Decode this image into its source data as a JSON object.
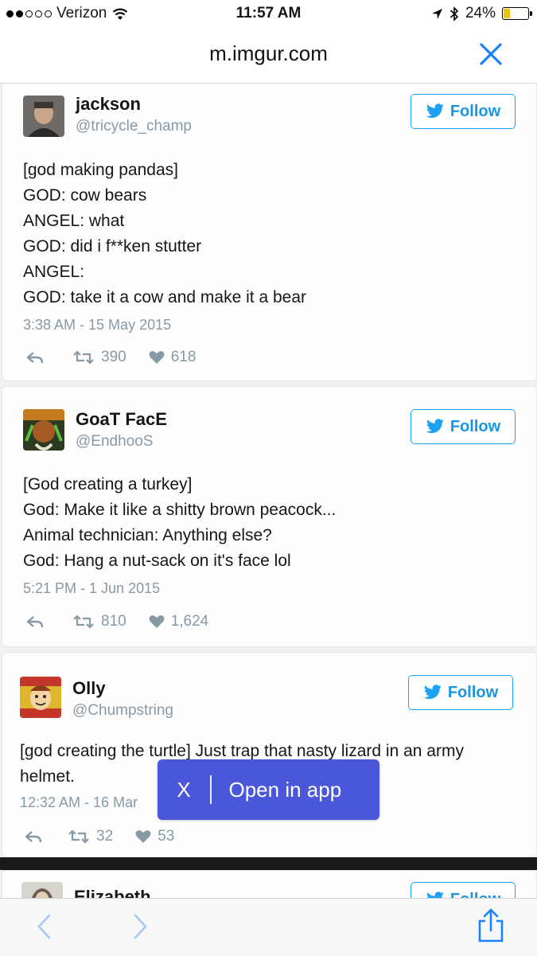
{
  "status_bar": {
    "carrier": "Verizon",
    "time": "11:57 AM",
    "battery": "24%",
    "battery_color": "#f3c00e"
  },
  "browser": {
    "url": "m.imgur.com"
  },
  "tweets": [
    {
      "name": "jackson",
      "handle": "@tricycle_champ",
      "follow_label": "Follow",
      "lines": [
        "[god making pandas]",
        "GOD: cow bears",
        "ANGEL: what",
        "GOD: did i f**ken stutter",
        "ANGEL:",
        "GOD: take it a cow and make it a bear"
      ],
      "timestamp": "3:38 AM - 15 May 2015",
      "retweets": "390",
      "likes": "618"
    },
    {
      "name": "GoaT FacE",
      "handle": "@EndhooS",
      "follow_label": "Follow",
      "lines": [
        "[God creating a turkey]",
        "God: Make it like a shitty brown peacock...",
        "Animal technician: Anything else?",
        "God: Hang a nut-sack on it's face lol"
      ],
      "timestamp": "5:21 PM - 1 Jun 2015",
      "retweets": "810",
      "likes": "1,624"
    },
    {
      "name": "Olly",
      "handle": "@Chumpstring",
      "follow_label": "Follow",
      "lines": [
        "[god creating the turtle] Just trap that nasty lizard in an army",
        "helmet."
      ],
      "timestamp": "12:32 AM - 16 Mar",
      "retweets": "32",
      "likes": "53"
    },
    {
      "name": "Elizabeth",
      "follow_label": "Follow"
    }
  ],
  "open_in_app": {
    "close_label": "X",
    "label": "Open in app",
    "color": "#4a57d8"
  },
  "colors": {
    "twitter_blue": "#1da1f2",
    "ios_blue": "#1a82fb",
    "muted": "#8899a6"
  }
}
